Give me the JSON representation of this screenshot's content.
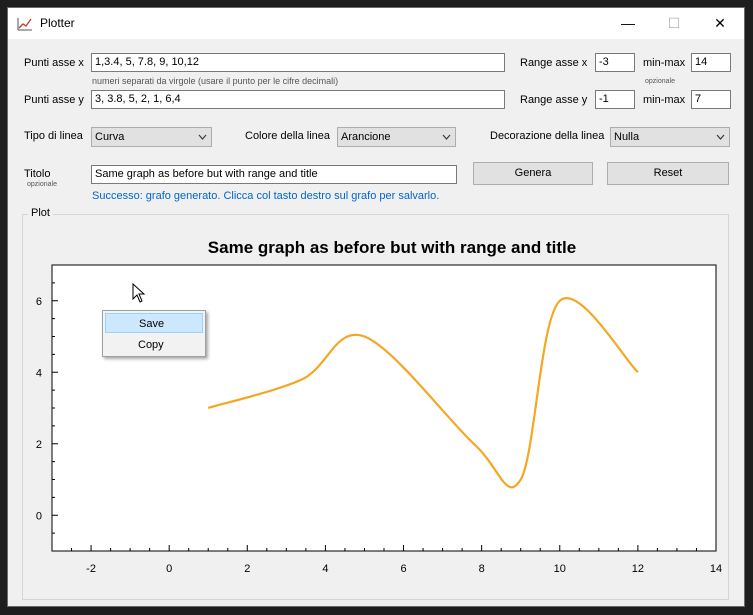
{
  "window": {
    "title": "Plotter",
    "minimize_glyph": "—",
    "maximize_glyph": "☐",
    "close_glyph": "✕"
  },
  "form": {
    "x_points_label": "Punti asse x",
    "x_points_value": "1,3.4, 5, 7.8, 9, 10,12",
    "x_points_hint": "numeri separati da virgole (usare il punto per le cifre decimali)",
    "y_points_label": "Punti asse y",
    "y_points_value": "3, 3.8, 5, 2, 1, 6,4",
    "range_x_label": "Range asse x",
    "range_x_min": "-3",
    "range_x_minmax_label": "min-max",
    "range_x_max": "14",
    "range_optional": "opzionale",
    "range_y_label": "Range asse y",
    "range_y_min": "-1",
    "range_y_minmax_label": "min-max",
    "range_y_max": "7",
    "line_type_label": "Tipo di linea",
    "line_type_value": "Curva",
    "line_color_label": "Colore della linea",
    "line_color_value": "Arancione",
    "decoration_label": "Decorazione della linea",
    "decoration_value": "Nulla",
    "title_label": "Titolo",
    "title_optional": "opzionale",
    "title_value": "Same graph as before but with range and title",
    "generate_button": "Genera",
    "reset_button": "Reset",
    "status": "Successo: grafo generato. Clicca col tasto destro sul grafo per salvarlo."
  },
  "plot_group": {
    "label": "Plot"
  },
  "context_menu": {
    "items": [
      "Save",
      "Copy"
    ]
  },
  "colors": {
    "line": "#f5a623",
    "status": "#0066cc"
  },
  "chart_data": {
    "type": "line",
    "title": "Same graph as before but with range and title",
    "x": [
      1,
      3.4,
      5,
      7.8,
      9,
      10,
      12
    ],
    "y": [
      3,
      3.8,
      5,
      2,
      1,
      6,
      4
    ],
    "xlim": [
      -3,
      14
    ],
    "ylim": [
      -1,
      7
    ],
    "xticks": [
      -2,
      0,
      2,
      4,
      6,
      8,
      10,
      12,
      14
    ],
    "yticks": [
      0,
      2,
      4,
      6
    ],
    "grid": false,
    "smooth": true
  }
}
